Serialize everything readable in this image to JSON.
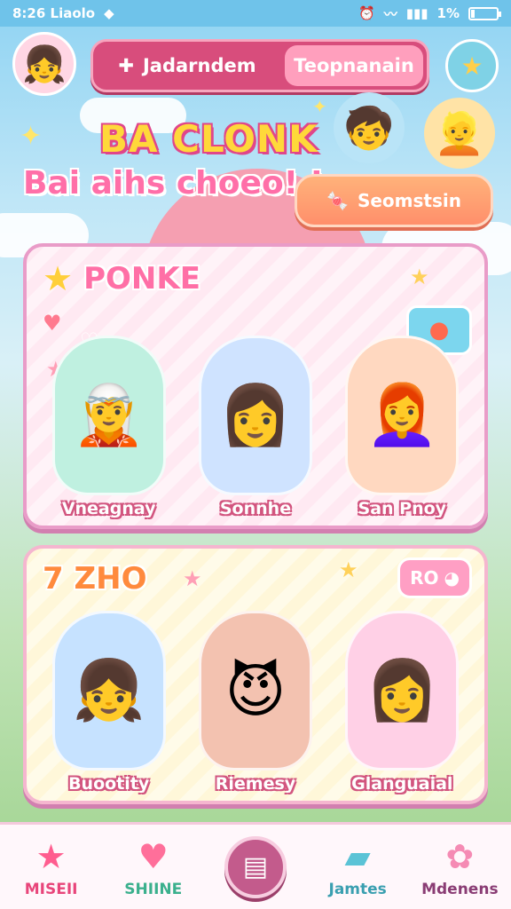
{
  "status_bar": {
    "left_text": "8:26 Liaolo",
    "battery_text": "1%",
    "icons": [
      "signal-icon",
      "diamond-icon",
      "alarm-icon",
      "wifi-icon",
      "battery-icon"
    ]
  },
  "header": {
    "tab_active_label": "Jadarndem",
    "tab_inactive_label": "Teopnanain",
    "title_main": "BA CLONK",
    "title_sub": "Bai aihs choeo! !",
    "search_button_label": "Seomstsin"
  },
  "cards": [
    {
      "title": "PONKE",
      "characters": [
        {
          "name": "Vneagnay"
        },
        {
          "name": "Sonnhe"
        },
        {
          "name": "San Pnoy"
        }
      ]
    },
    {
      "title": "7 ZHO",
      "badge": "RO",
      "characters": [
        {
          "name": "Buootity"
        },
        {
          "name": "Riemesy"
        },
        {
          "name": "Glanguaial"
        }
      ]
    }
  ],
  "bottom_nav": [
    {
      "label": "MISEII",
      "icon": "star-icon",
      "color": "#e8457a"
    },
    {
      "label": "SHIINE",
      "icon": "heart-icon",
      "color": "#3bb08d"
    },
    {
      "label": "",
      "icon": "notes-icon",
      "color": "#c35b8c"
    },
    {
      "label": "Jamtes",
      "icon": "folder-icon",
      "color": "#3a9fb0"
    },
    {
      "label": "Mdenens",
      "icon": "flower-icon",
      "color": "#8a3c74"
    }
  ],
  "colors": {
    "accent_pink": "#d84d7c",
    "accent_orange": "#ff8f6b",
    "sky": "#8fd3f2"
  }
}
